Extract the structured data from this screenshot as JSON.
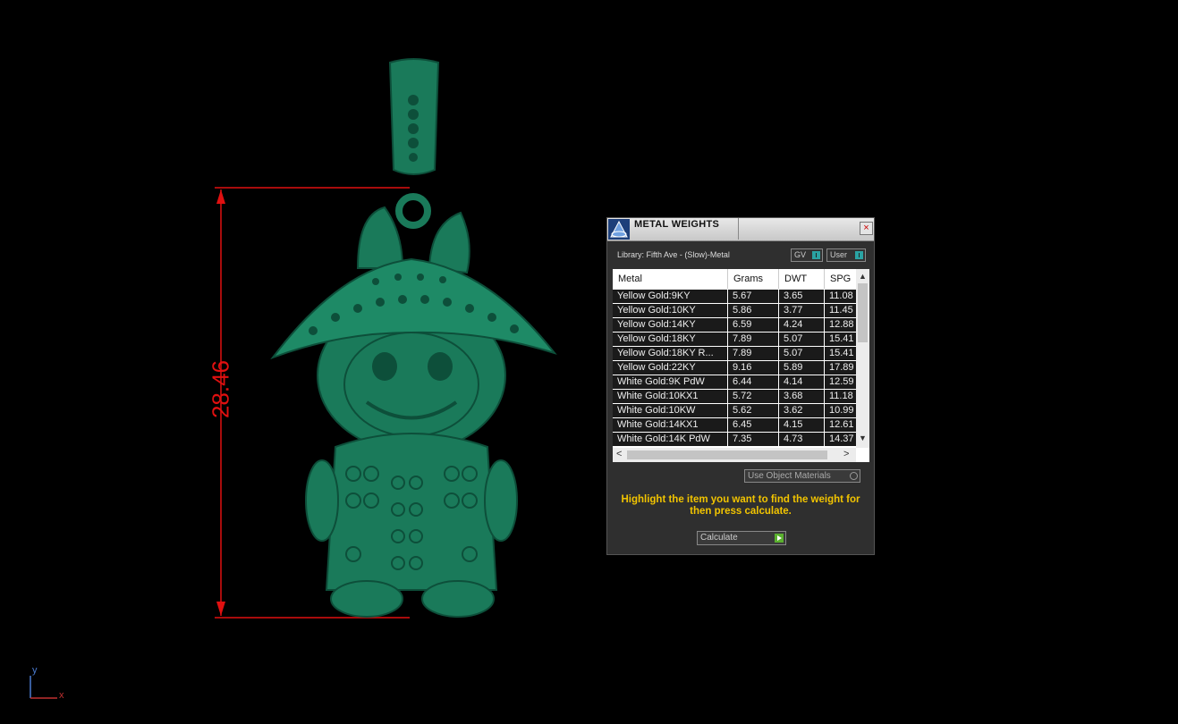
{
  "viewport": {
    "dimension_value": "28.46",
    "axis_y": "y",
    "axis_x": "x",
    "model_color": "#1a7a5a",
    "dimension_color": "#e01010"
  },
  "dialog": {
    "title": "METAL WEIGHTS",
    "close_icon": "×",
    "library": "Library: Fifth Ave - (Slow)-Metal",
    "gv_label": "GV",
    "user_label": "User",
    "columns": [
      "Metal",
      "Grams",
      "DWT",
      "SPG"
    ],
    "rows": [
      [
        "Yellow Gold:9KY",
        "5.67",
        "3.65",
        "11.08"
      ],
      [
        "Yellow Gold:10KY",
        "5.86",
        "3.77",
        "11.45"
      ],
      [
        "Yellow Gold:14KY",
        "6.59",
        "4.24",
        "12.88"
      ],
      [
        "Yellow Gold:18KY",
        "7.89",
        "5.07",
        "15.41"
      ],
      [
        "Yellow Gold:18KY R...",
        "7.89",
        "5.07",
        "15.41"
      ],
      [
        "Yellow Gold:22KY",
        "9.16",
        "5.89",
        "17.89"
      ],
      [
        "White Gold:9K PdW",
        "6.44",
        "4.14",
        "12.59"
      ],
      [
        "White Gold:10KX1",
        "5.72",
        "3.68",
        "11.18"
      ],
      [
        "White Gold:10KW",
        "5.62",
        "3.62",
        "10.99"
      ],
      [
        "White Gold:14KX1",
        "6.45",
        "4.15",
        "12.61"
      ],
      [
        "White Gold:14K PdW",
        "7.35",
        "4.73",
        "14.37"
      ]
    ],
    "use_object_materials": "Use Object Materials",
    "hint": "Highlight the item you want to find the weight for then press calculate.",
    "calculate_label": "Calculate",
    "scroll_up": "▲",
    "scroll_down": "▼",
    "scroll_left": "<",
    "scroll_right": ">",
    "hint_color": "#f2c400",
    "indicator_color": "#2aa3a3"
  }
}
